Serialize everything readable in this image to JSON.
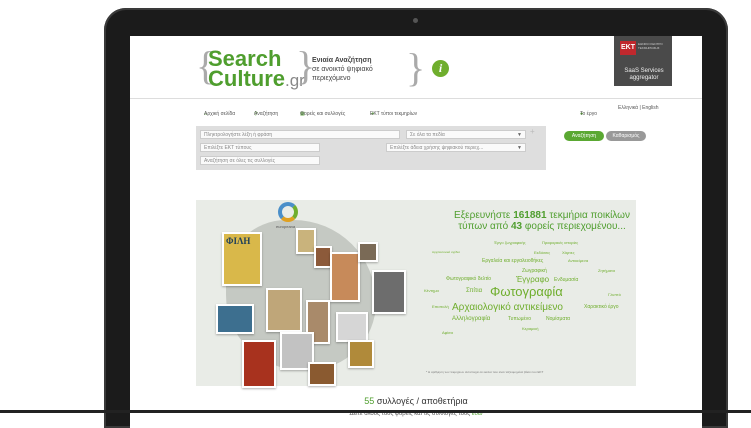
{
  "header": {
    "logo_line1": "Search",
    "logo_line2": "Culture",
    "logo_suffix": ".gr",
    "tagline_bold": "Ενιαία Αναζήτηση",
    "tagline_rest": "σε ανοικτό ψηφιακό περιεχόμενο",
    "info_icon": "i",
    "partner_badge": "ΕΚΤ",
    "partner_text": "ΕΘΝΙΚΟ ΚΕΝΤΡΟ ΤΕΚΜΗΡΙΩΣΗΣ",
    "partner_sub": "SaaS Services aggregator"
  },
  "nav": {
    "home": "Αρχική σελίδα",
    "search": "Αναζήτηση",
    "providers": "Φορείς και συλλογές",
    "types": "ΕΚΤ τύποι τεκμηρίων",
    "about": "Το έργο",
    "lang": "Ελληνικά | English"
  },
  "search": {
    "keyword_placeholder": "Πληκτρολογήστε λέξη ή φράση",
    "field_select": "Σε όλα τα πεδία",
    "type_select": "Επιλέξτε ΕΚΤ τύπους",
    "rights_select": "Επιλέξτε άδεια χρήσης ψηφιακού περιεχ...",
    "collection_placeholder": "Αναζήτηση σε όλες τις συλλογές",
    "search_button": "Αναζήτηση",
    "clear_button": "Καθαρισμός"
  },
  "cloud": {
    "headline_pre": "Εξερευνήστε",
    "count": "161881",
    "headline_mid": "τεκμήρια ποικίλων τύπων",
    "headline_from": "από",
    "providers": "43",
    "headline_end": "φορείς περιεχομένου...",
    "words": [
      "Έργο ζωγραφικής",
      "Προφορικές ιστορίες",
      "Εκδόσεις",
      "Χάρτες",
      "Αρχιτεκτονικά σχέδια",
      "Εργαλεία και εργαλειοθήκες",
      "Αντικείμενα",
      "Ζωγραφική",
      "Ζητήματα",
      "Φωτογραφικό δελτίο",
      "Έγγραφο",
      "Ενδυμασία",
      "Κέντημα",
      "Σπίτια",
      "Φωτογραφία",
      "Γλυπτό",
      "Αρχαιολογικό αντικείμενο",
      "Χαρακτικό έργο",
      "Επιστολή",
      "Αλληλογραφία",
      "Τυπωμένο",
      "Νομίσματα",
      "Κεραμική",
      "Αφίσα"
    ],
    "footnote": "* Η αρίθμηση των τεκμηρίων αντιστοιχεί σε εκείνα που είναι ταξινομημένα βάσει του ΕΚΤ"
  },
  "collections": {
    "count": "55",
    "label": "συλλογές / αποθετήρια",
    "sub_text": "Δείτε όλους τους φορείς και τις συλλογές τους",
    "sub_link": "εδώ"
  },
  "collage": {
    "ring_label": "europeana",
    "poster_text": "ΦΙΛΗ"
  }
}
